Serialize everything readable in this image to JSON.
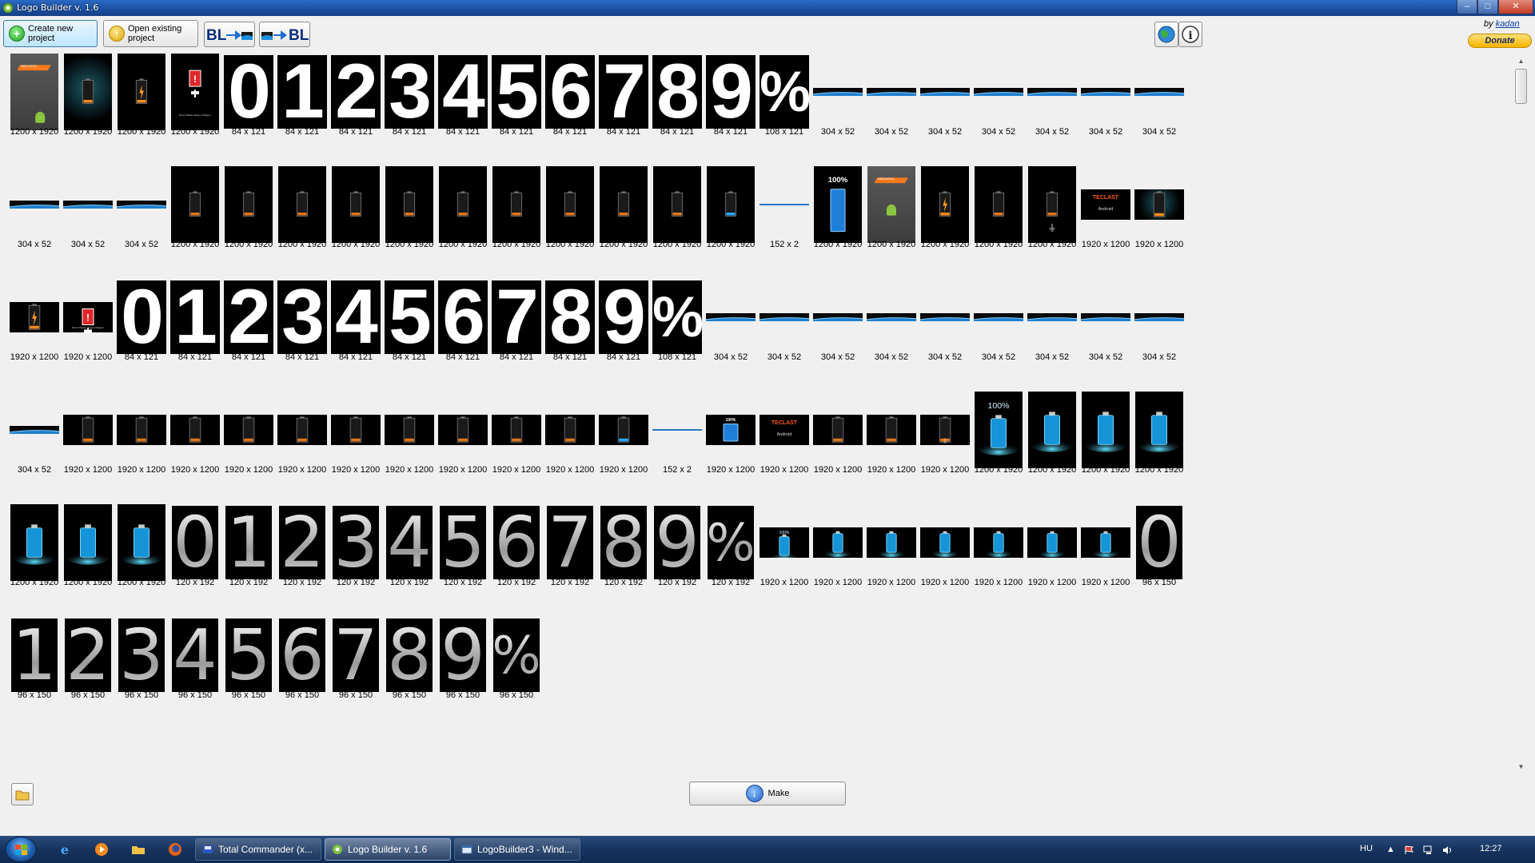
{
  "window": {
    "title": "Logo Builder v. 1.6",
    "controls": {
      "minimize": "–",
      "maximize": "□",
      "close": "✕"
    }
  },
  "toolbar": {
    "create_label": "Create new project",
    "open_label": "Open existing project",
    "bl_to_img_text": "BL",
    "img_to_bl_text": "BL",
    "byline_prefix": "by ",
    "byline_author": "kadan",
    "donate_label": "Donate"
  },
  "tiles": [
    [
      "1200 x 1920",
      "1200 x 1920",
      "1200 x 1920",
      "1200 x 1920",
      "84 x 121",
      "84 x 121",
      "84 x 121",
      "84 x 121",
      "84 x 121",
      "84 x 121",
      "84 x 121",
      "84 x 121",
      "84 x 121",
      "84 x 121",
      "108 x 121",
      "304 x 52",
      "304 x 52",
      "304 x 52",
      "304 x 52",
      "304 x 52",
      "304 x 52",
      "304 x 52"
    ],
    [
      "304 x 52",
      "304 x 52",
      "304 x 52",
      "1200 x 1920",
      "1200 x 1920",
      "1200 x 1920",
      "1200 x 1920",
      "1200 x 1920",
      "1200 x 1920",
      "1200 x 1920",
      "1200 x 1920",
      "1200 x 1920",
      "1200 x 1920",
      "1200 x 1920",
      "152 x 2",
      "1200 x 1920",
      "1200 x 1920",
      "1200 x 1920",
      "1200 x 1920",
      "1200 x 1920",
      "1920 x 1200",
      "1920 x 1200"
    ],
    [
      "1920 x 1200",
      "1920 x 1200",
      "84 x 121",
      "84 x 121",
      "84 x 121",
      "84 x 121",
      "84 x 121",
      "84 x 121",
      "84 x 121",
      "84 x 121",
      "84 x 121",
      "84 x 121",
      "108 x 121",
      "304 x 52",
      "304 x 52",
      "304 x 52",
      "304 x 52",
      "304 x 52",
      "304 x 52",
      "304 x 52",
      "304 x 52",
      "304 x 52"
    ],
    [
      "304 x 52",
      "1920 x 1200",
      "1920 x 1200",
      "1920 x 1200",
      "1920 x 1200",
      "1920 x 1200",
      "1920 x 1200",
      "1920 x 1200",
      "1920 x 1200",
      "1920 x 1200",
      "1920 x 1200",
      "1920 x 1200",
      "152 x 2",
      "1920 x 1200",
      "1920 x 1200",
      "1920 x 1200",
      "1920 x 1200",
      "1920 x 1200",
      "1200 x 1920",
      "1200 x 1920",
      "1200 x 1920",
      "1200 x 1920"
    ],
    [
      "1200 x 1920",
      "1200 x 1920",
      "1200 x 1920",
      "120 x 192",
      "120 x 192",
      "120 x 192",
      "120 x 192",
      "120 x 192",
      "120 x 192",
      "120 x 192",
      "120 x 192",
      "120 x 192",
      "120 x 192",
      "120 x 192",
      "1920 x 1200",
      "1920 x 1200",
      "1920 x 1200",
      "1920 x 1200",
      "1920 x 1200",
      "1920 x 1200",
      "1920 x 1200",
      "96 x 150"
    ],
    [
      "96 x 150",
      "96 x 150",
      "96 x 150",
      "96 x 150",
      "96 x 150",
      "96 x 150",
      "96 x 150",
      "96 x 150",
      "96 x 150",
      "96 x 150"
    ]
  ],
  "tile_text": {
    "digits": [
      "0",
      "1",
      "2",
      "3",
      "4",
      "5",
      "6",
      "7",
      "8",
      "9",
      "%"
    ],
    "android_brand": "MEDIATEK",
    "teclast_brand": "TECLAST",
    "android_word": "Android",
    "percent_full": "100%",
    "charge_msg": "Error! Please plug-in charger!"
  },
  "bottom": {
    "make_label": "Make"
  },
  "taskbar": {
    "tasks": [
      "Total Commander (x...",
      "Logo Builder v. 1.6",
      "LogoBuilder3 - Wind..."
    ],
    "lang": "HU",
    "clock": "12:27"
  },
  "colors": {
    "accent_blue": "#1a4fa0",
    "cyan_glow": "#29c7ff",
    "orange_brand": "#ff7a1a",
    "android_green": "#8cc63f"
  }
}
